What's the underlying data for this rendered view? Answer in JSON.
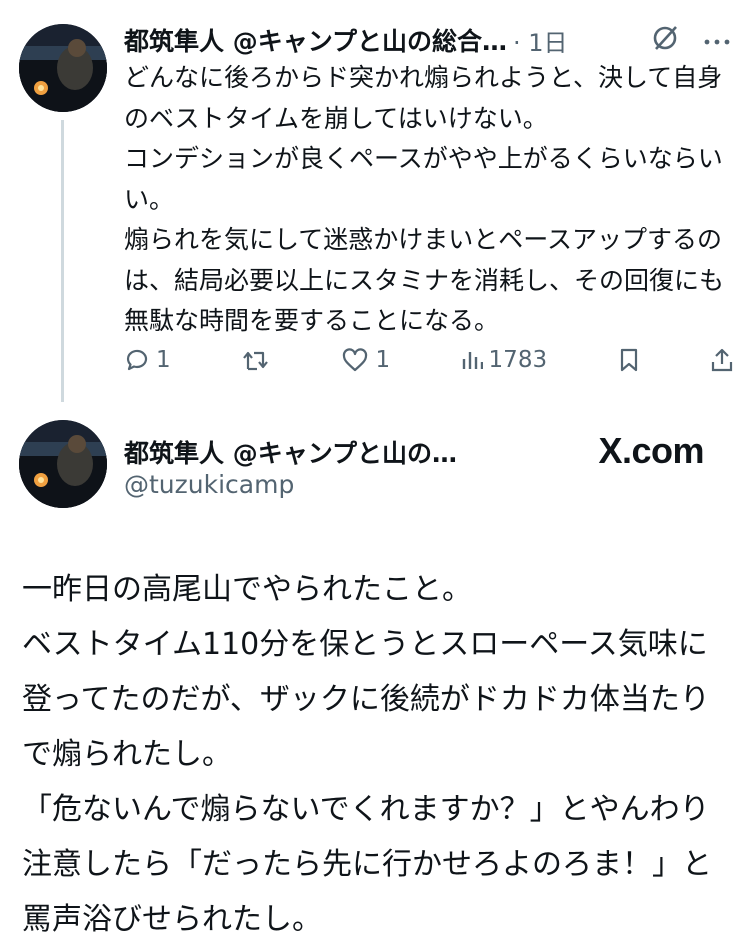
{
  "tweet1": {
    "name": "都筑隼人 @キャンプと山の総合…",
    "time": "· 1日",
    "text": "どんなに後ろからド突かれ煽られようと、決して自身のベストタイムを崩してはいけない。\nコンデションが良くペースがやや上がるくらいならいい。\n煽られを気にして迷惑かけまいとペースアップするのは、結局必要以上にスタミナを消耗し、その回復にも無駄な時間を要することになる。",
    "replies": "1",
    "likes": "1",
    "views": "1783"
  },
  "tweet2": {
    "name": "都筑隼人 @キャンプと山の…",
    "handle": "@tuzukicamp",
    "logo": "X.com",
    "text": "一昨日の高尾山でやられたこと。\nベストタイム110分を保とうとスローペース気味に登ってたのだが、ザックに後続がドカドカ体当たりで煽られたし。\n「危ないんで煽らないでくれますか？」とやんわり注意したら「だったら先に行かせろよのろま！」と罵声浴びせられたし。"
  },
  "icons": {
    "grok": "grok-icon",
    "more": "more-icon",
    "reply": "reply-icon",
    "retweet": "retweet-icon",
    "like": "like-icon",
    "views": "views-icon",
    "bookmark": "bookmark-icon",
    "share": "share-icon"
  }
}
